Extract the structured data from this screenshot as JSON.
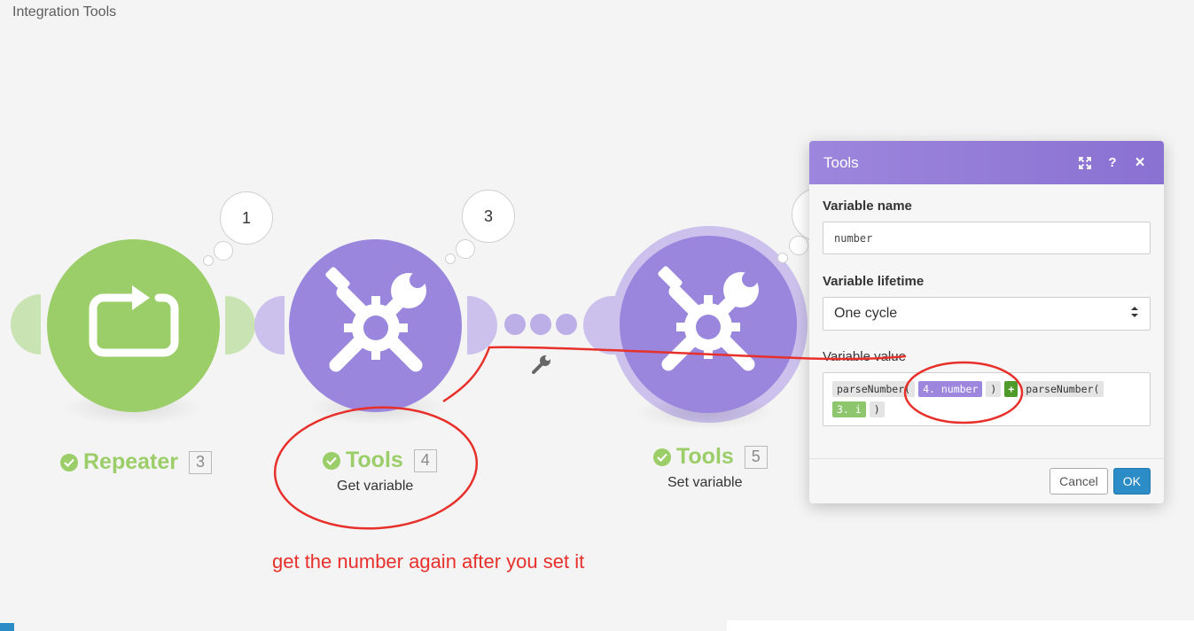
{
  "app": {
    "title": "Integration Tools"
  },
  "modules": [
    {
      "name": "Repeater",
      "count": "3",
      "bubble": "1",
      "subtitle": "",
      "color": "#9bcd68",
      "icon": "repeat-icon"
    },
    {
      "name": "Tools",
      "count": "4",
      "bubble": "3",
      "subtitle": "Get variable",
      "color": "#9a86dd",
      "icon": "tools-icon"
    },
    {
      "name": "Tools",
      "count": "5",
      "bubble": "",
      "subtitle": "Set variable",
      "color": "#9a86dd",
      "icon": "tools-icon"
    }
  ],
  "connector": {
    "icon": "wrench-icon"
  },
  "annotation": {
    "text": "get the number again after you set it",
    "color": "#e8302a"
  },
  "dialog": {
    "title": "Tools",
    "header_icons": [
      "expand-icon",
      "help-icon",
      "close-icon"
    ],
    "help_glyph": "?",
    "close_glyph": "×",
    "variable_name_label": "Variable name",
    "variable_name_value": "number",
    "variable_lifetime_label": "Variable lifetime",
    "variable_lifetime_value": "One cycle",
    "variable_value_label": "Variable value",
    "tokens": {
      "fn1": "parseNumber(",
      "ref1": "4. number",
      "close1": ")",
      "op": "+",
      "fn2": "parseNumber(",
      "ref2": "3. i",
      "close2": ")"
    },
    "cancel_label": "Cancel",
    "ok_label": "OK"
  },
  "colors": {
    "green": "#9bcd68",
    "purple": "#9a86dd",
    "header": "#9d86dd",
    "ok_button": "#2b8cc6"
  }
}
